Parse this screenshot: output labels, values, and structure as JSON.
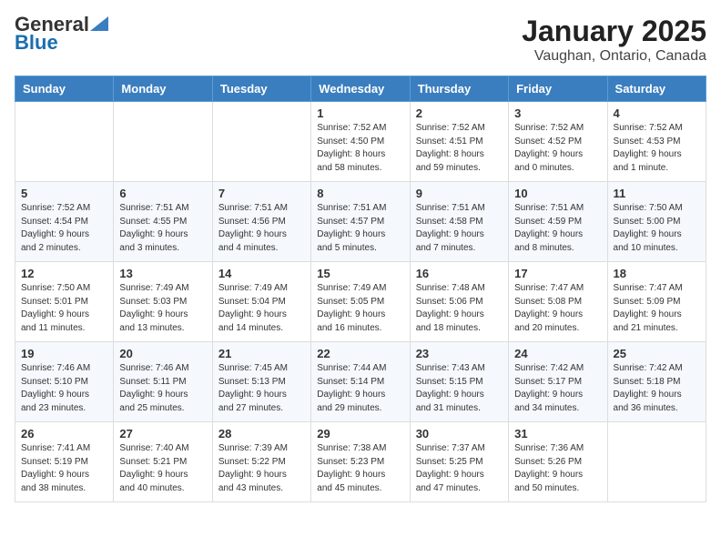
{
  "header": {
    "logo_general": "General",
    "logo_blue": "Blue",
    "title": "January 2025",
    "subtitle": "Vaughan, Ontario, Canada"
  },
  "weekdays": [
    "Sunday",
    "Monday",
    "Tuesday",
    "Wednesday",
    "Thursday",
    "Friday",
    "Saturday"
  ],
  "weeks": [
    [
      {
        "day": "",
        "info": ""
      },
      {
        "day": "",
        "info": ""
      },
      {
        "day": "",
        "info": ""
      },
      {
        "day": "1",
        "info": "Sunrise: 7:52 AM\nSunset: 4:50 PM\nDaylight: 8 hours\nand 58 minutes."
      },
      {
        "day": "2",
        "info": "Sunrise: 7:52 AM\nSunset: 4:51 PM\nDaylight: 8 hours\nand 59 minutes."
      },
      {
        "day": "3",
        "info": "Sunrise: 7:52 AM\nSunset: 4:52 PM\nDaylight: 9 hours\nand 0 minutes."
      },
      {
        "day": "4",
        "info": "Sunrise: 7:52 AM\nSunset: 4:53 PM\nDaylight: 9 hours\nand 1 minute."
      }
    ],
    [
      {
        "day": "5",
        "info": "Sunrise: 7:52 AM\nSunset: 4:54 PM\nDaylight: 9 hours\nand 2 minutes."
      },
      {
        "day": "6",
        "info": "Sunrise: 7:51 AM\nSunset: 4:55 PM\nDaylight: 9 hours\nand 3 minutes."
      },
      {
        "day": "7",
        "info": "Sunrise: 7:51 AM\nSunset: 4:56 PM\nDaylight: 9 hours\nand 4 minutes."
      },
      {
        "day": "8",
        "info": "Sunrise: 7:51 AM\nSunset: 4:57 PM\nDaylight: 9 hours\nand 5 minutes."
      },
      {
        "day": "9",
        "info": "Sunrise: 7:51 AM\nSunset: 4:58 PM\nDaylight: 9 hours\nand 7 minutes."
      },
      {
        "day": "10",
        "info": "Sunrise: 7:51 AM\nSunset: 4:59 PM\nDaylight: 9 hours\nand 8 minutes."
      },
      {
        "day": "11",
        "info": "Sunrise: 7:50 AM\nSunset: 5:00 PM\nDaylight: 9 hours\nand 10 minutes."
      }
    ],
    [
      {
        "day": "12",
        "info": "Sunrise: 7:50 AM\nSunset: 5:01 PM\nDaylight: 9 hours\nand 11 minutes."
      },
      {
        "day": "13",
        "info": "Sunrise: 7:49 AM\nSunset: 5:03 PM\nDaylight: 9 hours\nand 13 minutes."
      },
      {
        "day": "14",
        "info": "Sunrise: 7:49 AM\nSunset: 5:04 PM\nDaylight: 9 hours\nand 14 minutes."
      },
      {
        "day": "15",
        "info": "Sunrise: 7:49 AM\nSunset: 5:05 PM\nDaylight: 9 hours\nand 16 minutes."
      },
      {
        "day": "16",
        "info": "Sunrise: 7:48 AM\nSunset: 5:06 PM\nDaylight: 9 hours\nand 18 minutes."
      },
      {
        "day": "17",
        "info": "Sunrise: 7:47 AM\nSunset: 5:08 PM\nDaylight: 9 hours\nand 20 minutes."
      },
      {
        "day": "18",
        "info": "Sunrise: 7:47 AM\nSunset: 5:09 PM\nDaylight: 9 hours\nand 21 minutes."
      }
    ],
    [
      {
        "day": "19",
        "info": "Sunrise: 7:46 AM\nSunset: 5:10 PM\nDaylight: 9 hours\nand 23 minutes."
      },
      {
        "day": "20",
        "info": "Sunrise: 7:46 AM\nSunset: 5:11 PM\nDaylight: 9 hours\nand 25 minutes."
      },
      {
        "day": "21",
        "info": "Sunrise: 7:45 AM\nSunset: 5:13 PM\nDaylight: 9 hours\nand 27 minutes."
      },
      {
        "day": "22",
        "info": "Sunrise: 7:44 AM\nSunset: 5:14 PM\nDaylight: 9 hours\nand 29 minutes."
      },
      {
        "day": "23",
        "info": "Sunrise: 7:43 AM\nSunset: 5:15 PM\nDaylight: 9 hours\nand 31 minutes."
      },
      {
        "day": "24",
        "info": "Sunrise: 7:42 AM\nSunset: 5:17 PM\nDaylight: 9 hours\nand 34 minutes."
      },
      {
        "day": "25",
        "info": "Sunrise: 7:42 AM\nSunset: 5:18 PM\nDaylight: 9 hours\nand 36 minutes."
      }
    ],
    [
      {
        "day": "26",
        "info": "Sunrise: 7:41 AM\nSunset: 5:19 PM\nDaylight: 9 hours\nand 38 minutes."
      },
      {
        "day": "27",
        "info": "Sunrise: 7:40 AM\nSunset: 5:21 PM\nDaylight: 9 hours\nand 40 minutes."
      },
      {
        "day": "28",
        "info": "Sunrise: 7:39 AM\nSunset: 5:22 PM\nDaylight: 9 hours\nand 43 minutes."
      },
      {
        "day": "29",
        "info": "Sunrise: 7:38 AM\nSunset: 5:23 PM\nDaylight: 9 hours\nand 45 minutes."
      },
      {
        "day": "30",
        "info": "Sunrise: 7:37 AM\nSunset: 5:25 PM\nDaylight: 9 hours\nand 47 minutes."
      },
      {
        "day": "31",
        "info": "Sunrise: 7:36 AM\nSunset: 5:26 PM\nDaylight: 9 hours\nand 50 minutes."
      },
      {
        "day": "",
        "info": ""
      }
    ]
  ]
}
